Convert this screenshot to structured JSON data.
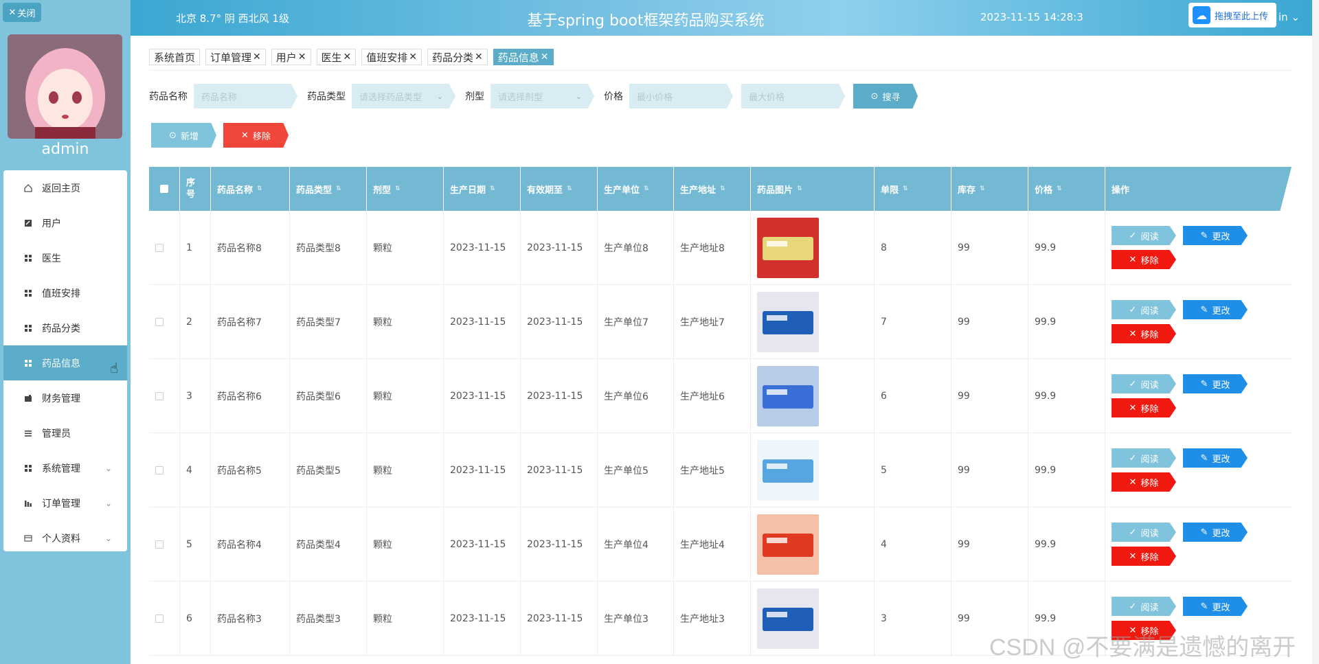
{
  "sidebar": {
    "close_label": "关闭",
    "username": "admin",
    "items": [
      {
        "label": "返回主页",
        "icon": "home-icon"
      },
      {
        "label": "用户",
        "icon": "edit-icon"
      },
      {
        "label": "医生",
        "icon": "grid-icon"
      },
      {
        "label": "值班安排",
        "icon": "grid-icon"
      },
      {
        "label": "药品分类",
        "icon": "grid-icon"
      },
      {
        "label": "药品信息",
        "icon": "grid-icon"
      },
      {
        "label": "财务管理",
        "icon": "wallet-icon"
      },
      {
        "label": "管理员",
        "icon": "list-icon"
      },
      {
        "label": "系统管理",
        "icon": "grid-icon"
      },
      {
        "label": "订单管理",
        "icon": "chart-icon"
      },
      {
        "label": "个人资料",
        "icon": "card-icon"
      }
    ],
    "active": "药品信息"
  },
  "header": {
    "weather": "北京  8.7°  阴  西北风  1级",
    "title": "基于spring boot框架药品购买系统",
    "datetime": "2023-11-15 14:28:3",
    "upload_label": "拖拽至此上传",
    "user_suffix": "in"
  },
  "tabs": [
    {
      "label": "系统首页",
      "closable": false
    },
    {
      "label": "订单管理",
      "closable": true
    },
    {
      "label": "用户",
      "closable": true
    },
    {
      "label": "医生",
      "closable": true
    },
    {
      "label": "值班安排",
      "closable": true
    },
    {
      "label": "药品分类",
      "closable": true
    },
    {
      "label": "药品信息",
      "closable": true
    }
  ],
  "search": {
    "name_label": "药品名称",
    "name_placeholder": "药品名称",
    "type_label": "药品类型",
    "type_placeholder": "请选择药品类型",
    "form_label": "剂型",
    "form_placeholder": "请选择剂型",
    "price_label": "价格",
    "min_placeholder": "最小价格",
    "max_placeholder": "最大价格",
    "search_button": "搜寻"
  },
  "actions": {
    "add": "新增",
    "remove": "移除"
  },
  "table": {
    "headers": [
      "序号",
      "药品名称",
      "药品类型",
      "剂型",
      "生产日期",
      "有效期至",
      "生产单位",
      "生产地址",
      "药品图片",
      "单限",
      "库存",
      "价格",
      "操作"
    ],
    "rows": [
      {
        "index": "1",
        "name": "药品名称8",
        "type": "药品类型8",
        "form": "颗粒",
        "prod_date": "2023-11-15",
        "expiry": "2023-11-15",
        "unit": "生产单位8",
        "address": "生产地址8",
        "limit": "8",
        "stock": "99",
        "price": "99.9"
      },
      {
        "index": "2",
        "name": "药品名称7",
        "type": "药品类型7",
        "form": "颗粒",
        "prod_date": "2023-11-15",
        "expiry": "2023-11-15",
        "unit": "生产单位7",
        "address": "生产地址7",
        "limit": "7",
        "stock": "99",
        "price": "99.9"
      },
      {
        "index": "3",
        "name": "药品名称6",
        "type": "药品类型6",
        "form": "颗粒",
        "prod_date": "2023-11-15",
        "expiry": "2023-11-15",
        "unit": "生产单位6",
        "address": "生产地址6",
        "limit": "6",
        "stock": "99",
        "price": "99.9"
      },
      {
        "index": "4",
        "name": "药品名称5",
        "type": "药品类型5",
        "form": "颗粒",
        "prod_date": "2023-11-15",
        "expiry": "2023-11-15",
        "unit": "生产单位5",
        "address": "生产地址5",
        "limit": "5",
        "stock": "99",
        "price": "99.9"
      },
      {
        "index": "5",
        "name": "药品名称4",
        "type": "药品类型4",
        "form": "颗粒",
        "prod_date": "2023-11-15",
        "expiry": "2023-11-15",
        "unit": "生产单位4",
        "address": "生产地址4",
        "limit": "4",
        "stock": "99",
        "price": "99.9"
      },
      {
        "index": "6",
        "name": "药品名称3",
        "type": "药品类型3",
        "form": "颗粒",
        "prod_date": "2023-11-15",
        "expiry": "2023-11-15",
        "unit": "生产单位3",
        "address": "生产地址3",
        "limit": "3",
        "stock": "99",
        "price": "99.9"
      }
    ],
    "op_labels": {
      "read": "阅读",
      "edit": "更改",
      "remove": "移除"
    }
  },
  "watermark": "CSDN @不要满是遗憾的离开",
  "colors": {
    "sidebar": "#7fc4dc",
    "accent": "#5aacc9",
    "danger": "#f0473a",
    "edit": "#1e8ee6"
  }
}
